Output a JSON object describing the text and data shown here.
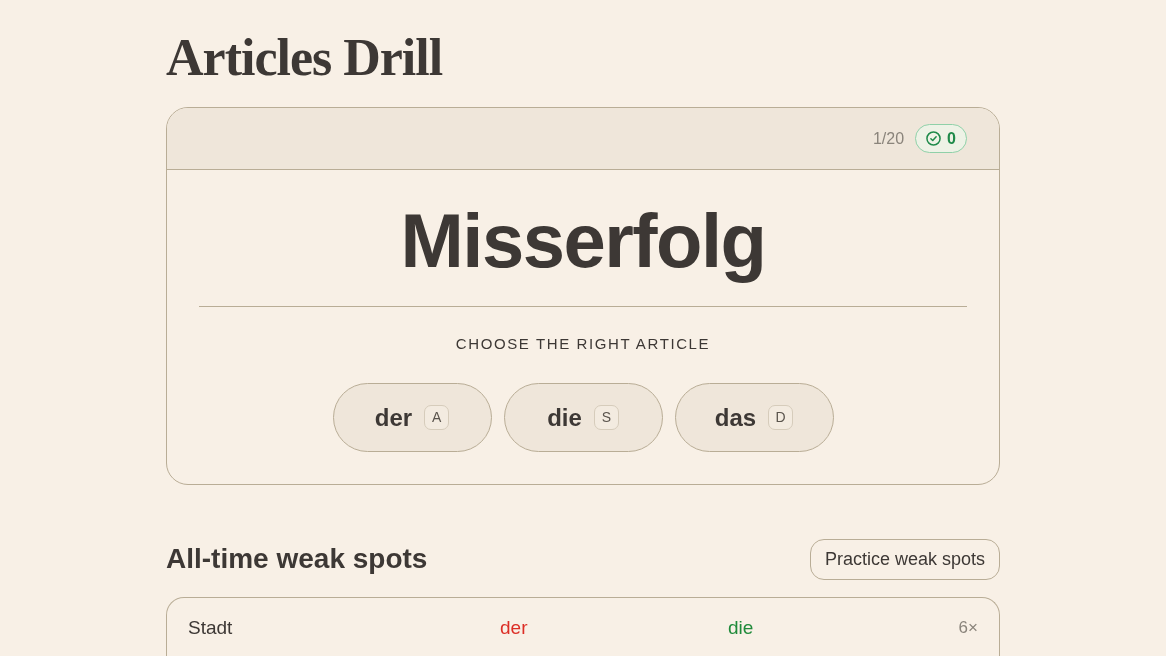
{
  "title": "Articles Drill",
  "quiz": {
    "progress": "1/20",
    "correct_count": "0",
    "word": "Misserfolg",
    "prompt": "CHOOSE THE RIGHT ARTICLE",
    "options": [
      {
        "label": "der",
        "key": "A"
      },
      {
        "label": "die",
        "key": "S"
      },
      {
        "label": "das",
        "key": "D"
      }
    ]
  },
  "weak_spots": {
    "heading": "All-time weak spots",
    "practice_button": "Practice weak spots",
    "rows": [
      {
        "word": "Stadt",
        "wrong": "der",
        "correct": "die",
        "count": "6×"
      }
    ]
  }
}
